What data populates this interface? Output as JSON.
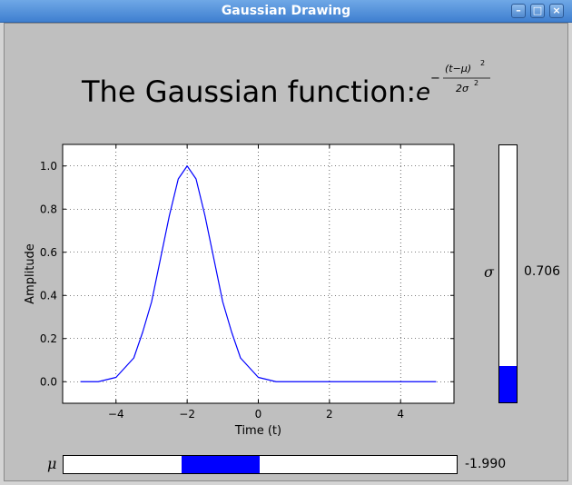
{
  "window": {
    "title": "Gaussian Drawing",
    "minimize_glyph": "–",
    "maximize_glyph": "□",
    "close_glyph": "×"
  },
  "heading": {
    "text": "The Gaussian function:"
  },
  "formula": {
    "base": "e",
    "sign": "−",
    "numerator": "(t−μ)",
    "num_exp": "2",
    "denominator": "2σ",
    "den_exp": "2"
  },
  "chart_data": {
    "type": "line",
    "xlabel": "Time (t)",
    "ylabel": "Amplitude",
    "xlim": [
      -5.5,
      5.5
    ],
    "ylim": [
      -0.1,
      1.1
    ],
    "xticks": [
      -4,
      -2,
      0,
      2,
      4
    ],
    "xtick_labels": [
      "−4",
      "−2",
      "0",
      "2",
      "4"
    ],
    "yticks": [
      0.0,
      0.2,
      0.4,
      0.6,
      0.8,
      1.0
    ],
    "ytick_labels": [
      "0.0",
      "0.2",
      "0.4",
      "0.6",
      "0.8",
      "1.0"
    ],
    "grid": true,
    "series": [
      {
        "color": "#0000ff",
        "x": [
          -5.0,
          -4.5,
          -4.0,
          -3.5,
          -3.25,
          -3.0,
          -2.75,
          -2.5,
          -2.25,
          -2.0,
          -1.75,
          -1.5,
          -1.25,
          -1.0,
          -0.75,
          -0.5,
          0.0,
          0.5,
          1.0,
          2.0,
          3.0,
          4.0,
          5.0
        ],
        "y": [
          0.0,
          0.0,
          0.02,
          0.11,
          0.23,
          0.37,
          0.57,
          0.77,
          0.94,
          1.0,
          0.94,
          0.77,
          0.57,
          0.37,
          0.23,
          0.11,
          0.02,
          0.0,
          0.0,
          0.0,
          0.0,
          0.0,
          0.0
        ]
      }
    ]
  },
  "sigma_slider": {
    "symbol": "σ",
    "value_text": "0.706",
    "fill_fraction": 0.14
  },
  "mu_slider": {
    "symbol": "μ",
    "value_text": "-1.990",
    "fill_start_fraction": 0.3,
    "fill_end_fraction": 0.5
  }
}
